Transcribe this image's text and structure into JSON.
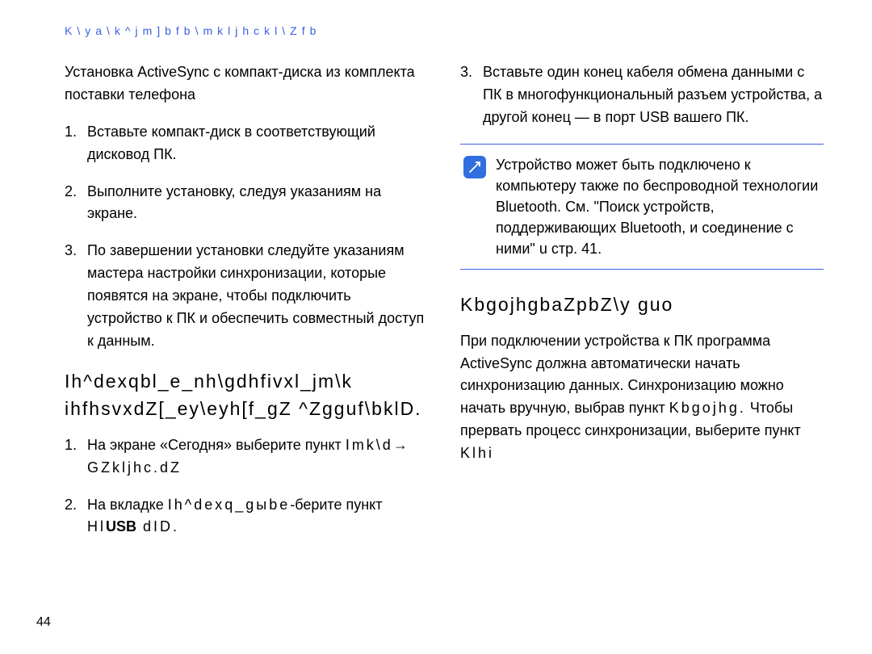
{
  "header": "K\\ya\\k^jm]bfb\\mkljhckl\\Zfb",
  "left": {
    "intro": "Установка ActiveSync с компакт-диска из комплекта поставки телефона",
    "steps": [
      {
        "n": "1.",
        "t": "Вставьте компакт-диск в соответствующий дисковод ПК."
      },
      {
        "n": "2.",
        "t": "Выполните установку, следуя указаниям на экране."
      },
      {
        "n": "3.",
        "t": "По завершении установки следуйте указаниям мастера настройки синхронизации, которые появятся на экране, чтобы подключить устройство к ПК и обеспечить совместный доступ к данным."
      }
    ],
    "section_title": "Ih^dexqbl_e_nh\\gdhfivxl_jm\\k ihfhsvxdZ[_ey\\eyh[f_gZ ^Zgguf\\bklD.",
    "steps2_item1_prefix": "1.",
    "steps2_item1_line1": "На экране «Сегодня» выберите пункт ",
    "steps2_item1_line2": "Imk\\d→ GZkljhc.dZ",
    "steps2_item2_prefix": "2.",
    "steps2_item2_a": "На вкладке ",
    "steps2_item2_b": "Ih^dexq_gыbе",
    "steps2_item2_c": "-берите пункт ",
    "steps2_item2_d": "Hl",
    "steps2_item2_e": "USB",
    "steps2_item2_f": " dID."
  },
  "right": {
    "step3_n": "3.",
    "step3_t": "Вставьте один конец кабеля обмена данными с ПК в многофункциональный разъем устройства, а другой конец — в порт USB вашего ПК.",
    "note": "Устройство может быть подключено к компьютеру также по беспроводной технологии Bluetooth. См. \"Поиск устройств, поддерживающих Bluetooth, и соединение с ними\" u  стр. 41.",
    "section_title": "KbgojhgbaZpbZ\\y  guo",
    "para_a": "При подключении устройства к ПК программа ActiveSync должна автоматически начать синхронизацию данных. Синхронизацию можно начать вручную, выбрав пункт ",
    "para_b": "Kbgojhg.",
    "para_c": " Чтобы прервать процесс синхронизации, выберите пункт ",
    "para_d": "Klhi"
  },
  "page_number": "44"
}
